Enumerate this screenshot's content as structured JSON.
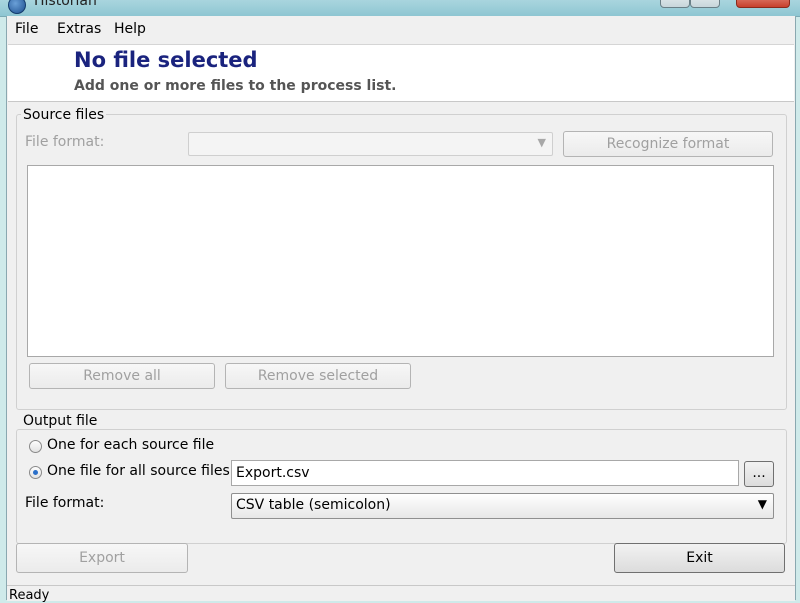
{
  "window": {
    "title": "Historian"
  },
  "menu": [
    "File",
    "Extras",
    "Help"
  ],
  "header": {
    "title": "No file selected",
    "subtitle": "Add one or more files to the process list."
  },
  "source": {
    "legend": "Source files",
    "format_label": "File format:",
    "format_value": "",
    "recognize_button": "Recognize format",
    "remove_all_button": "Remove all",
    "remove_selected_button": "Remove selected",
    "files": []
  },
  "output": {
    "legend": "Output file",
    "option_each": "One for each source file",
    "option_all": "One file for all source files:",
    "selected_option": "all",
    "filename": "Export.csv",
    "browse_button": "...",
    "format_label": "File format:",
    "format_value": "CSV table (semicolon)"
  },
  "buttons": {
    "export": "Export",
    "exit": "Exit"
  },
  "status": {
    "text": "Ready"
  }
}
